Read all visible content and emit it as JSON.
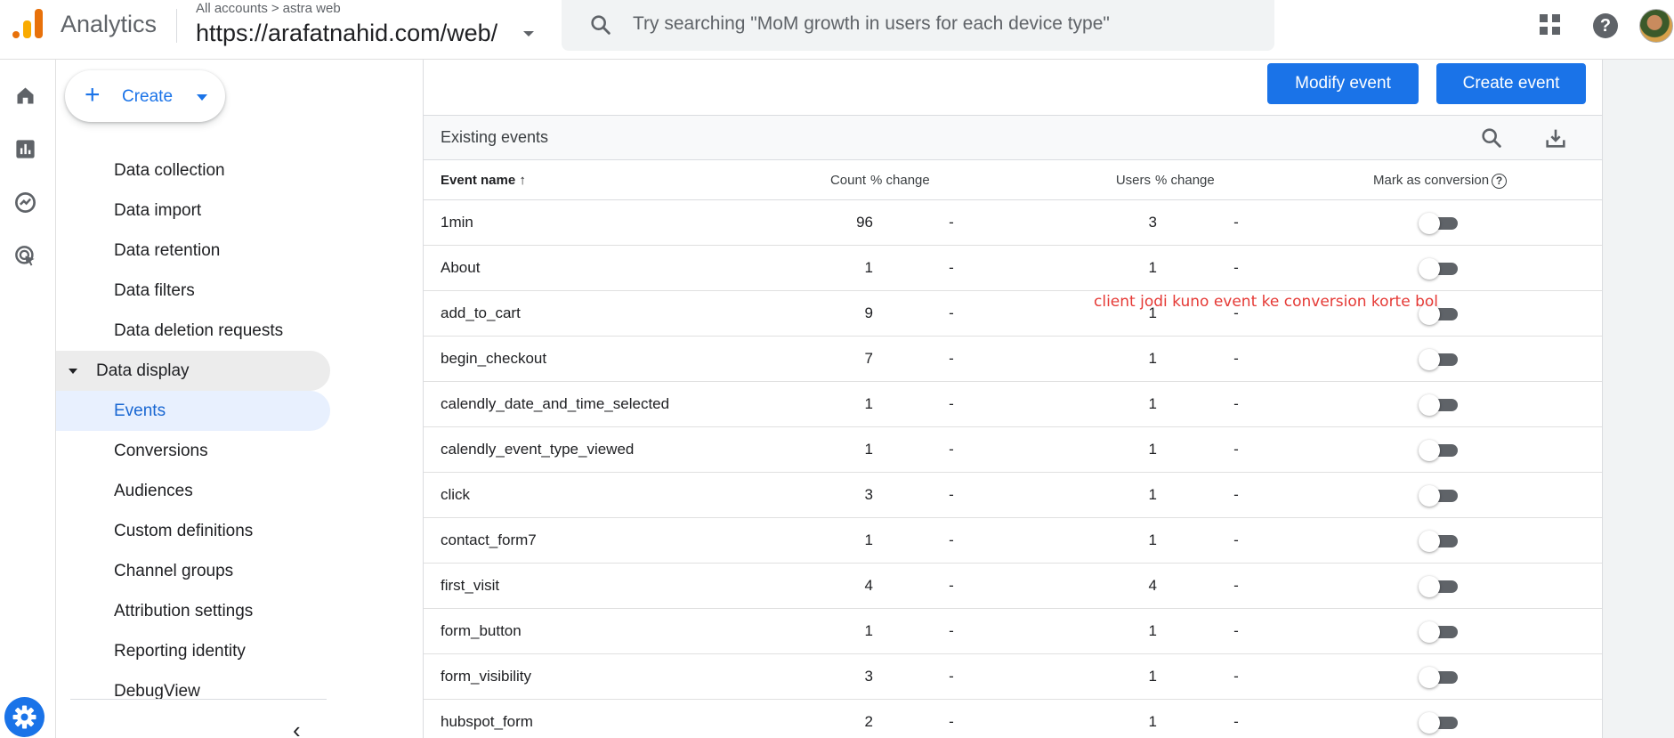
{
  "app": {
    "name": "Analytics"
  },
  "account": {
    "breadcrumb_account": "All accounts",
    "breadcrumb_property": "astra web",
    "property_url": "https://arafatnahid.com/web/"
  },
  "search": {
    "placeholder": "Try searching \"MoM growth in users for each device type\""
  },
  "topbar_icons": [
    "apps-grid-icon",
    "help-icon",
    "avatar"
  ],
  "rail_icons": [
    "home-icon",
    "reports-icon",
    "explore-icon",
    "advertising-icon",
    "admin-gear-icon"
  ],
  "create": {
    "label": "Create"
  },
  "nav": {
    "items": [
      {
        "label": "Data collection"
      },
      {
        "label": "Data import"
      },
      {
        "label": "Data retention"
      },
      {
        "label": "Data filters"
      },
      {
        "label": "Data deletion requests"
      }
    ],
    "section": {
      "label": "Data display"
    },
    "display_items": [
      {
        "label": "Events"
      },
      {
        "label": "Conversions"
      },
      {
        "label": "Audiences"
      },
      {
        "label": "Custom definitions"
      },
      {
        "label": "Channel groups"
      },
      {
        "label": "Attribution settings"
      },
      {
        "label": "Reporting identity"
      },
      {
        "label": "DebugView"
      }
    ],
    "active": "Events"
  },
  "actions": {
    "modify_event": "Modify event",
    "create_event": "Create event"
  },
  "table": {
    "title": "Existing events",
    "columns": {
      "event_name": "Event name",
      "count": "Count",
      "count_change": "% change",
      "users": "Users",
      "users_change": "% change",
      "mark_conversion": "Mark as conversion"
    },
    "sort": "ascending",
    "rows": [
      {
        "name": "1min",
        "count": "96",
        "count_change": "-",
        "users": "3",
        "users_change": "-",
        "conversion": false
      },
      {
        "name": "About",
        "count": "1",
        "count_change": "-",
        "users": "1",
        "users_change": "-",
        "conversion": false
      },
      {
        "name": "add_to_cart",
        "count": "9",
        "count_change": "-",
        "users": "1",
        "users_change": "-",
        "conversion": false
      },
      {
        "name": "begin_checkout",
        "count": "7",
        "count_change": "-",
        "users": "1",
        "users_change": "-",
        "conversion": false
      },
      {
        "name": "calendly_date_and_time_selected",
        "count": "1",
        "count_change": "-",
        "users": "1",
        "users_change": "-",
        "conversion": false
      },
      {
        "name": "calendly_event_type_viewed",
        "count": "1",
        "count_change": "-",
        "users": "1",
        "users_change": "-",
        "conversion": false
      },
      {
        "name": "click",
        "count": "3",
        "count_change": "-",
        "users": "1",
        "users_change": "-",
        "conversion": false
      },
      {
        "name": "contact_form7",
        "count": "1",
        "count_change": "-",
        "users": "1",
        "users_change": "-",
        "conversion": false
      },
      {
        "name": "first_visit",
        "count": "4",
        "count_change": "-",
        "users": "4",
        "users_change": "-",
        "conversion": false
      },
      {
        "name": "form_button",
        "count": "1",
        "count_change": "-",
        "users": "1",
        "users_change": "-",
        "conversion": false
      },
      {
        "name": "form_visibility",
        "count": "3",
        "count_change": "-",
        "users": "1",
        "users_change": "-",
        "conversion": false
      },
      {
        "name": "hubspot_form",
        "count": "2",
        "count_change": "-",
        "users": "1",
        "users_change": "-",
        "conversion": false
      }
    ]
  },
  "annotation": {
    "text": "client jodi kuno event ke conversion korte bole"
  },
  "colors": {
    "accent": "#1a73e8",
    "active_bg": "#e8f0fe",
    "annotation": "#e53935",
    "logo_orange": "#e8710a",
    "logo_yellow": "#f9ab00"
  }
}
